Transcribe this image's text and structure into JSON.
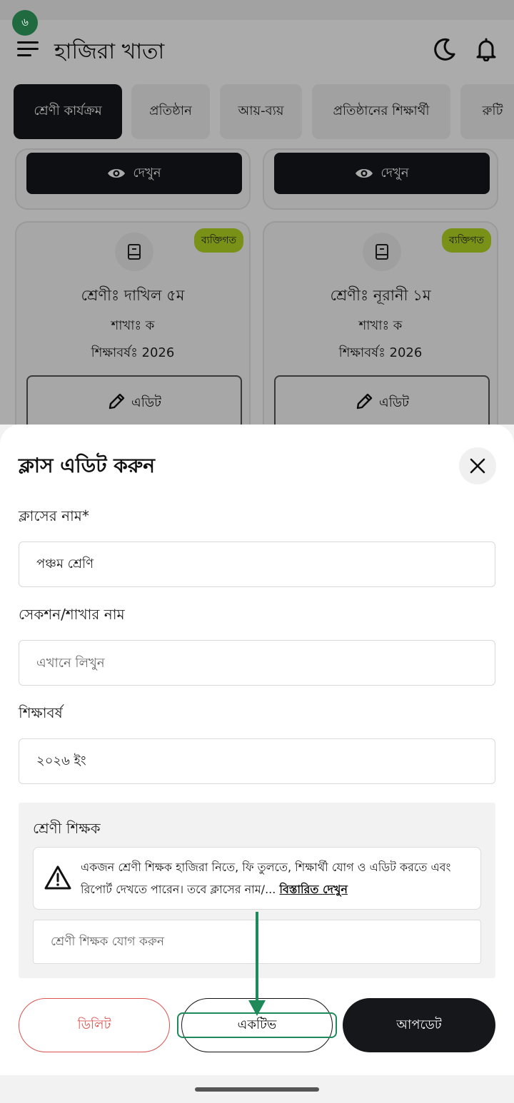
{
  "status": {
    "notification_badge": "৬"
  },
  "app": {
    "title": "হাজিরা খাতা",
    "tabs": [
      {
        "label": "শ্রেণী কার্যক্রম",
        "active": true
      },
      {
        "label": "প্রতিষ্ঠান",
        "active": false
      },
      {
        "label": "আয়-ব্যয়",
        "active": false
      },
      {
        "label": "প্রতিষ্ঠানের শিক্ষার্থী",
        "active": false
      },
      {
        "label": "রুটি",
        "active": false
      }
    ],
    "view_label": "দেখুন",
    "cards": [
      {
        "badge": "ব্যক্তিগত",
        "class_name": "শ্রেণীঃ দাখিল ৫ম",
        "section": "শাখাঃ ক",
        "year": "শিক্ষাবর্ষঃ 2026",
        "edit_label": "এডিট"
      },
      {
        "badge": "ব্যক্তিগত",
        "class_name": "শ্রেণীঃ নূরানী ১ম",
        "section": "শাখাঃ ক",
        "year": "শিক্ষাবর্ষঃ 2026",
        "edit_label": "এডিট"
      }
    ]
  },
  "sheet": {
    "title": "ক্লাস এডিট করুন",
    "class_name": {
      "label": "ক্লাসের নাম*",
      "value": "পঞ্চম শ্রেণি"
    },
    "section_name": {
      "label": "সেকশন/শাখার নাম",
      "placeholder": "এখানে লিখুন"
    },
    "academic_year": {
      "label": "শিক্ষাবর্ষ",
      "value": "২০২৬ ইং"
    },
    "class_teacher": {
      "label": "শ্রেণী শিক্ষক",
      "info_text": "একজন শ্রেণী শিক্ষক হাজিরা নিতে, ফি তুলতে, শিক্ষার্থী যোগ ও এডিট করতে এবং রিপোর্ট দেখতে পারেন। তবে ক্লাসের নাম/... ",
      "info_link": "বিস্তারিত দেখুন",
      "placeholder": "শ্রেণী শিক্ষক যোগ করুন"
    },
    "buttons": {
      "delete": "ডিলিট",
      "active": "একটিভ",
      "update": "আপডেট"
    }
  },
  "colors": {
    "accent_dark": "#15171b",
    "badge": "#b5d922",
    "delete": "#d9534f",
    "highlight": "#1e8a5a"
  }
}
